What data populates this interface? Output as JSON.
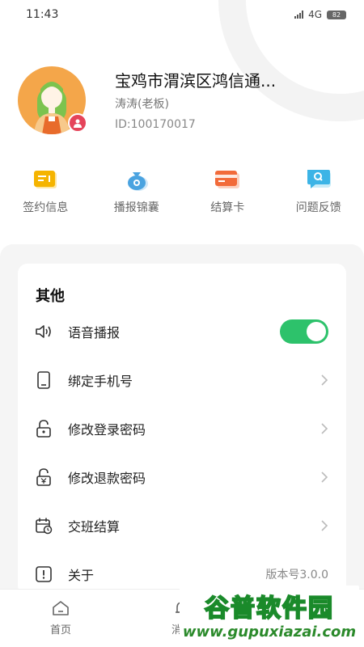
{
  "status": {
    "time": "11:43",
    "network": "4G",
    "battery": "82"
  },
  "profile": {
    "shop_name": "宝鸡市渭滨区鸿信通...",
    "owner": "涛涛(老板)",
    "id": "ID:100170017"
  },
  "quick_actions": [
    {
      "label": "签约信息",
      "icon": "contract-icon",
      "color": "#f5b400"
    },
    {
      "label": "播报锦囊",
      "icon": "money-bag-icon",
      "color": "#4aa3e0"
    },
    {
      "label": "结算卡",
      "icon": "card-icon",
      "color": "#f26b3a"
    },
    {
      "label": "问题反馈",
      "icon": "feedback-icon",
      "color": "#3cb4e6"
    }
  ],
  "settings": {
    "title": "其他",
    "items": [
      {
        "label": "语音播报",
        "icon": "speaker-icon",
        "control": "toggle",
        "on": true
      },
      {
        "label": "绑定手机号",
        "icon": "phone-icon",
        "control": "chevron"
      },
      {
        "label": "修改登录密码",
        "icon": "lock-icon",
        "control": "chevron"
      },
      {
        "label": "修改退款密码",
        "icon": "yuan-lock-icon",
        "control": "chevron"
      },
      {
        "label": "交班结算",
        "icon": "calendar-icon",
        "control": "chevron"
      },
      {
        "label": "关于",
        "icon": "info-icon",
        "control": "value",
        "value": "版本号3.0.0"
      }
    ]
  },
  "tabbar": {
    "items": [
      {
        "label": "首页",
        "icon": "home-icon"
      },
      {
        "label": "消息",
        "icon": "bell-icon"
      }
    ]
  },
  "watermark": {
    "title": "谷普软件园",
    "url": "www.gupuxiazai.com"
  },
  "colors": {
    "accent_green": "#2dc26b",
    "avatar_orange": "#f4a64a",
    "badge_red": "#e5445a"
  }
}
